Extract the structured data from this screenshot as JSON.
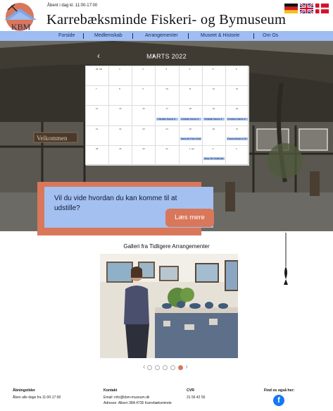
{
  "header": {
    "logo_text": "KBM",
    "open_hours": "Åbent i dag kl. 11:00-17:00",
    "title": "Karrebæksminde Fiskeri- og Bymuseum",
    "flags": [
      "german-flag",
      "uk-flag",
      "danish-flag"
    ]
  },
  "nav": {
    "items": [
      "Forside",
      "Medlemskab",
      "Arrangementer",
      "Museet & Historie",
      "Om Os"
    ]
  },
  "hero": {
    "welcome_sign": "Velkommen"
  },
  "calendar": {
    "month_label": "MARTS 2022",
    "prev_icon": "‹",
    "next_icon": "›",
    "weeks": [
      [
        {
          "day": "28. feb"
        },
        {
          "day": "1"
        },
        {
          "day": "2"
        },
        {
          "day": "3"
        },
        {
          "day": "4"
        },
        {
          "day": "5"
        },
        {
          "day": "6"
        }
      ],
      [
        {
          "day": "7"
        },
        {
          "day": "8"
        },
        {
          "day": "9"
        },
        {
          "day": "10"
        },
        {
          "day": "11"
        },
        {
          "day": "12"
        },
        {
          "day": "13"
        }
      ],
      [
        {
          "day": "14"
        },
        {
          "day": "15"
        },
        {
          "day": "16"
        },
        {
          "day": "17",
          "event": "Christian Nanne &"
        },
        {
          "day": "18",
          "event": "Christian Nanne &"
        },
        {
          "day": "19",
          "event": "Christian Nanne &"
        },
        {
          "day": "20",
          "event": "Christian Nanne &"
        }
      ],
      [
        {
          "day": "21"
        },
        {
          "day": "22"
        },
        {
          "day": "23"
        },
        {
          "day": "24"
        },
        {
          "day": "25",
          "event": "Sonia de Fries Seidl"
        },
        {
          "day": "26"
        },
        {
          "day": "27",
          "event": "Francis Bowie & St"
        }
      ],
      [
        {
          "day": "28"
        },
        {
          "day": "29"
        },
        {
          "day": "30"
        },
        {
          "day": "31"
        },
        {
          "day": "1. apr"
        },
        {
          "day": "2",
          "event": "Hans Ole Hutlecher"
        },
        {
          "day": "3"
        }
      ]
    ]
  },
  "cta": {
    "text": "Vil du vide hvordan du kan komme til at udstille?",
    "button": "Læs mere"
  },
  "gallery": {
    "title": "Galleri fra Tidligere Arrangementer",
    "active_index": 4,
    "count": 5
  },
  "footer": {
    "hours_heading": "Åbningstider",
    "hours_text": "Åben alle dage fra 11:00-17:00",
    "contact_heading": "Kontakt",
    "contact_email": "Email: info@kbm-museum.dk",
    "contact_address": "Adresse: Alleen 38A 4736 Karrebæksminde",
    "cvr_heading": "CVR",
    "cvr_number": "31 56 42 56",
    "social_heading": "Find os også her:",
    "social_icon": "facebook-icon"
  },
  "colors": {
    "nav_blue": "#9fbdf2",
    "accent_orange": "#d9775a",
    "cta_blue": "#a4c0f0",
    "facebook_blue": "#1877f2"
  }
}
